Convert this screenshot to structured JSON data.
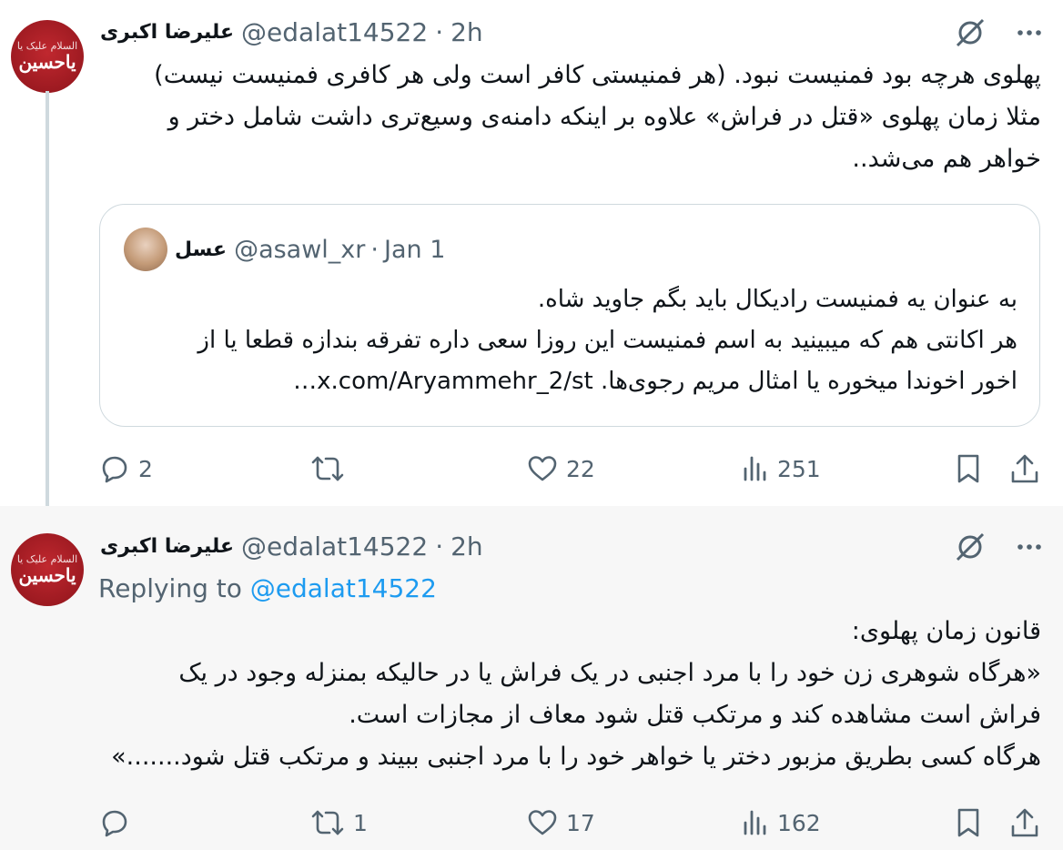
{
  "tweet1": {
    "avatar_text_small": "السلام علیک یا",
    "avatar_text_big": "یاحسین",
    "author_name": "علیرضا اکبری",
    "handle": "@edalat14522",
    "time": "2h",
    "lines": [
      "پهلوی هرچه بود فمنیست نبود. (هر فمنیستی کافر است ولی هر کافری فمنیست نیست)",
      "مثلا زمان پهلوی «قتل در فراش» علاوه بر اینکه دامنه‌ی وسیع‌تری داشت شامل دختر و",
      "خواهر هم می‌شد.."
    ],
    "quote": {
      "author_name": "عسل",
      "handle": "@asawl_xr",
      "time": "Jan 1",
      "lines": [
        "به عنوان یه فمنیست رادیکال باید بگم جاوید شاه.",
        "هر اکانتی هم که میبینید به اسم فمنیست این روزا سعی داره تفرقه بندازه قطعا یا از",
        "اخور اخوندا میخوره یا امثال مریم رجوی‌ها. x.com/Aryammehr_2/st…"
      ]
    },
    "actions": {
      "replies": "2",
      "reposts": "",
      "likes": "22",
      "views": "251"
    }
  },
  "tweet2": {
    "avatar_text_small": "السلام علیک یا",
    "avatar_text_big": "یاحسین",
    "author_name": "علیرضا اکبری",
    "handle": "@edalat14522",
    "time": "2h",
    "replying_prefix": "Replying to",
    "replying_to": "@edalat14522",
    "lines": [
      "قانون زمان پهلوی:",
      "«هرگاه شوهری زن خود را با مرد اجنبی در یک فراش یا در حالیکه بمنزله وجود در یک",
      "فراش است مشاهده کند و مرتکب قتل شود معاف از مجازات است.",
      "هرگاه کسی بطریق مزبور دختر یا خواهر خود را با مرد اجنبی ببیند و مرتکب قتل شود.......»"
    ],
    "actions": {
      "replies": "",
      "reposts": "1",
      "likes": "17",
      "views": "162"
    }
  },
  "icons": {
    "grok": "grok-icon",
    "more": "more-icon",
    "reply": "reply-icon",
    "repost": "repost-icon",
    "like": "like-icon",
    "views": "views-icon",
    "bookmark": "bookmark-icon",
    "share": "share-icon"
  },
  "colors": {
    "secondary_text": "#536471",
    "link": "#1d9bf0",
    "avatar_red": "#9d1a21"
  }
}
